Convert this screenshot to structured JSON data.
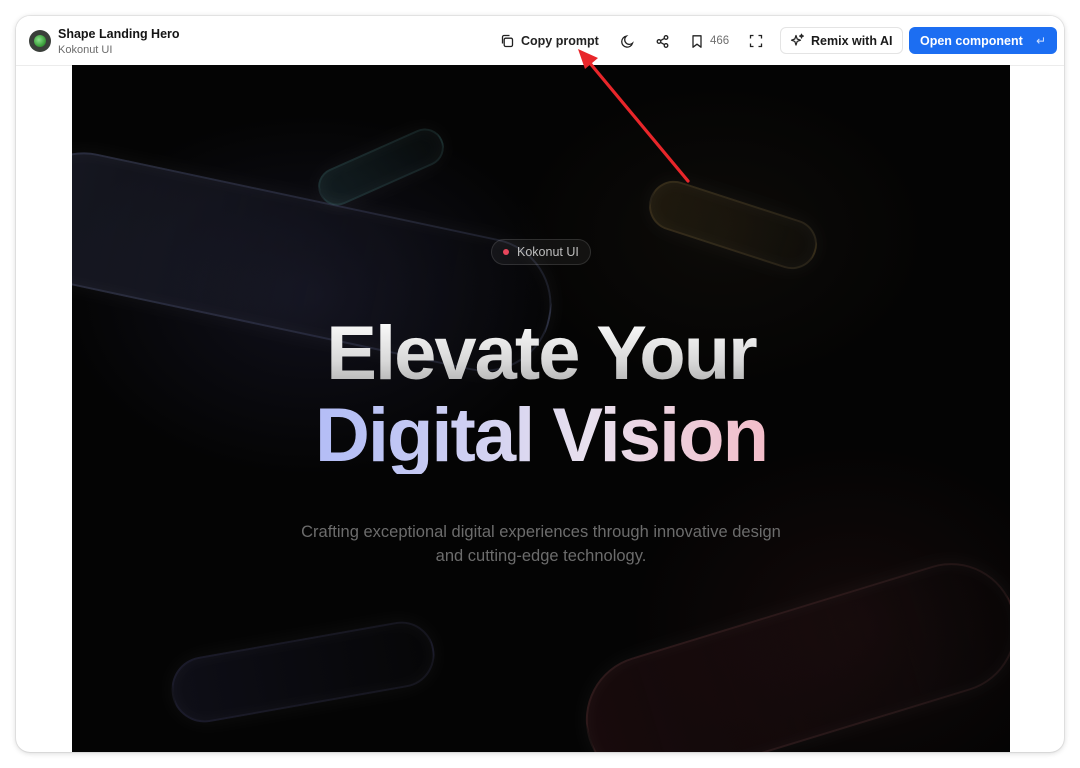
{
  "header": {
    "title": "Shape Landing Hero",
    "subtitle": "Kokonut UI",
    "copy_prompt_label": "Copy prompt",
    "bookmark_count": "466",
    "remix_label": "Remix with AI",
    "open_label": "Open component",
    "open_shortcut_glyph": "↵"
  },
  "hero": {
    "badge_text": "Kokonut UI",
    "headline_line1": "Elevate Your",
    "headline_line2": "Digital Vision",
    "subtext": "Crafting exceptional digital experiences through innovative design and cutting-edge technology."
  },
  "icons": {
    "brand": "brand-logo-icon",
    "copy": "copy-icon",
    "theme": "moon-icon",
    "share": "share-icon",
    "bookmark": "bookmark-icon",
    "fullscreen": "fullscreen-icon",
    "remix": "sparkles-icon",
    "enter": "enter-icon"
  },
  "colors": {
    "accent_button": "#1c6ef2",
    "hero_background": "#040404",
    "badge_dot": "#e8465c",
    "headline_gradient_start": "#a3b0ff",
    "headline_gradient_end": "#fa8fa6",
    "annotation_arrow": "#e8262a"
  }
}
